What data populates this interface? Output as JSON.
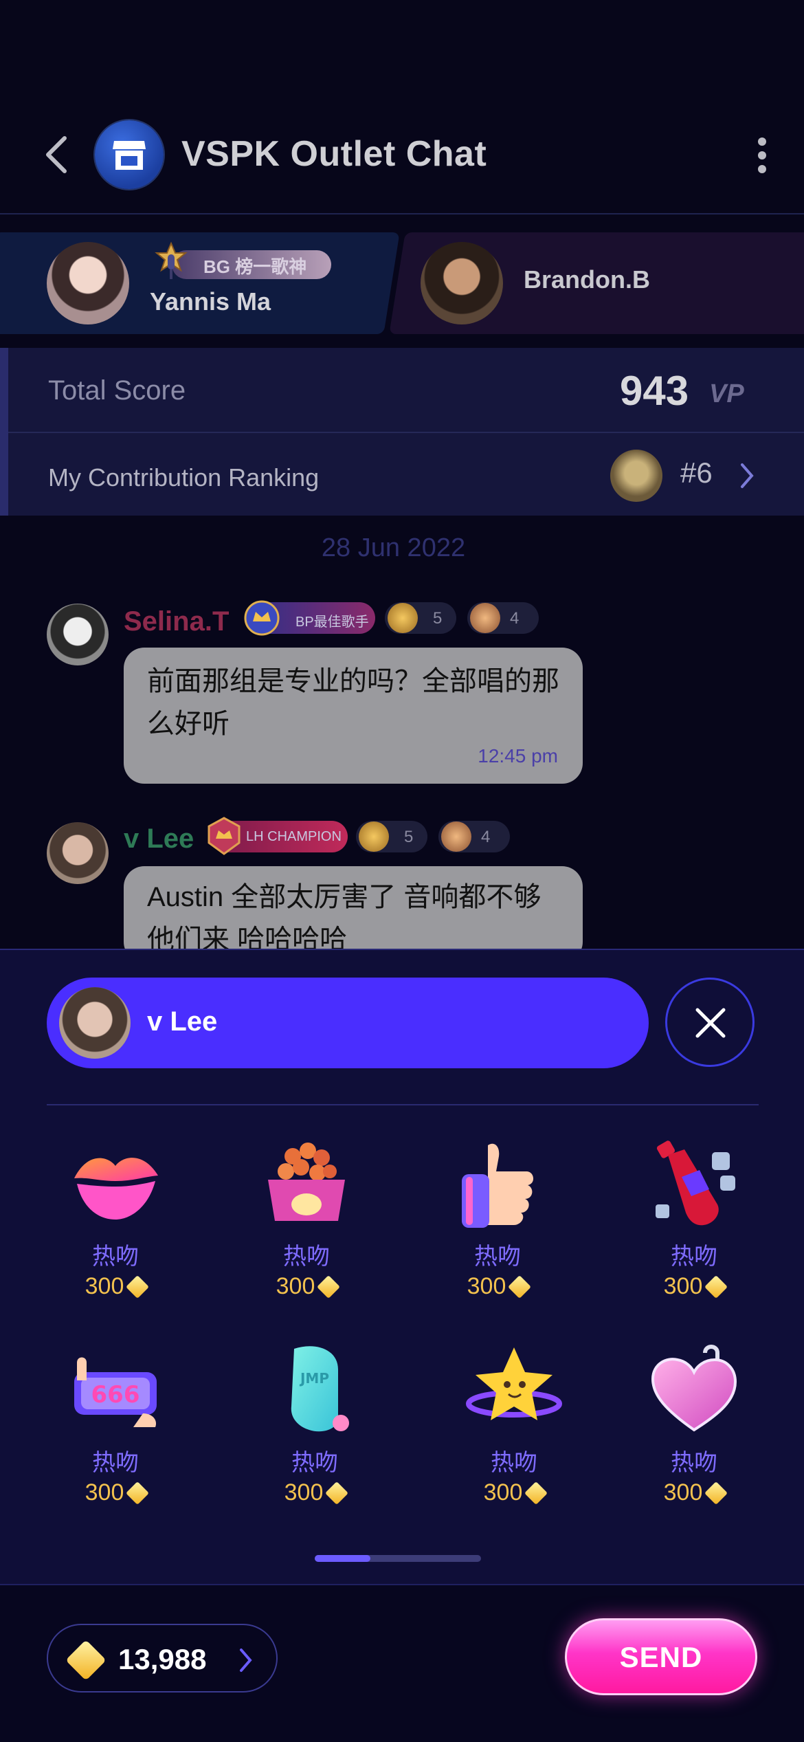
{
  "header": {
    "title": "VSPK Outlet Chat"
  },
  "contestants": [
    {
      "name": "Yannis Ma",
      "badge": "BG 榜一歌神"
    },
    {
      "name": "Brandon.B"
    }
  ],
  "score": {
    "label": "Total Score",
    "value": "943",
    "unit": "VP"
  },
  "ranking": {
    "label": "My Contribution Ranking",
    "value": "#6"
  },
  "chat": {
    "date": "28 Jun 2022",
    "messages": [
      {
        "name": "Selina.T",
        "badge": "BP最佳歌手",
        "level1": "5",
        "level2": "4",
        "text": "前面那组是专业的吗？全部唱的那么好听",
        "time": "12:45 pm"
      },
      {
        "name": "v Lee",
        "badge": "LH CHAMPION",
        "level1": "5",
        "level2": "4",
        "text": "Austin 全部太厉害了 音响都不够他们来 哈哈哈哈"
      }
    ]
  },
  "gift_panel": {
    "recipient": "v Lee",
    "gifts": [
      {
        "name": "热吻",
        "price": "300",
        "icon": "lips-icon"
      },
      {
        "name": "热吻",
        "price": "300",
        "icon": "food-bowl-icon"
      },
      {
        "name": "热吻",
        "price": "300",
        "icon": "thumbs-up-icon"
      },
      {
        "name": "热吻",
        "price": "300",
        "icon": "soda-bottle-icon"
      },
      {
        "name": "热吻",
        "price": "300",
        "icon": "phone-666-icon"
      },
      {
        "name": "热吻",
        "price": "300",
        "icon": "jelly-icon"
      },
      {
        "name": "热吻",
        "price": "300",
        "icon": "star-planet-icon"
      },
      {
        "name": "热吻",
        "price": "300",
        "icon": "heart-lock-icon"
      }
    ],
    "pager": {
      "page": 1,
      "pages": 3
    },
    "balance": "13,988",
    "send_label": "SEND"
  }
}
